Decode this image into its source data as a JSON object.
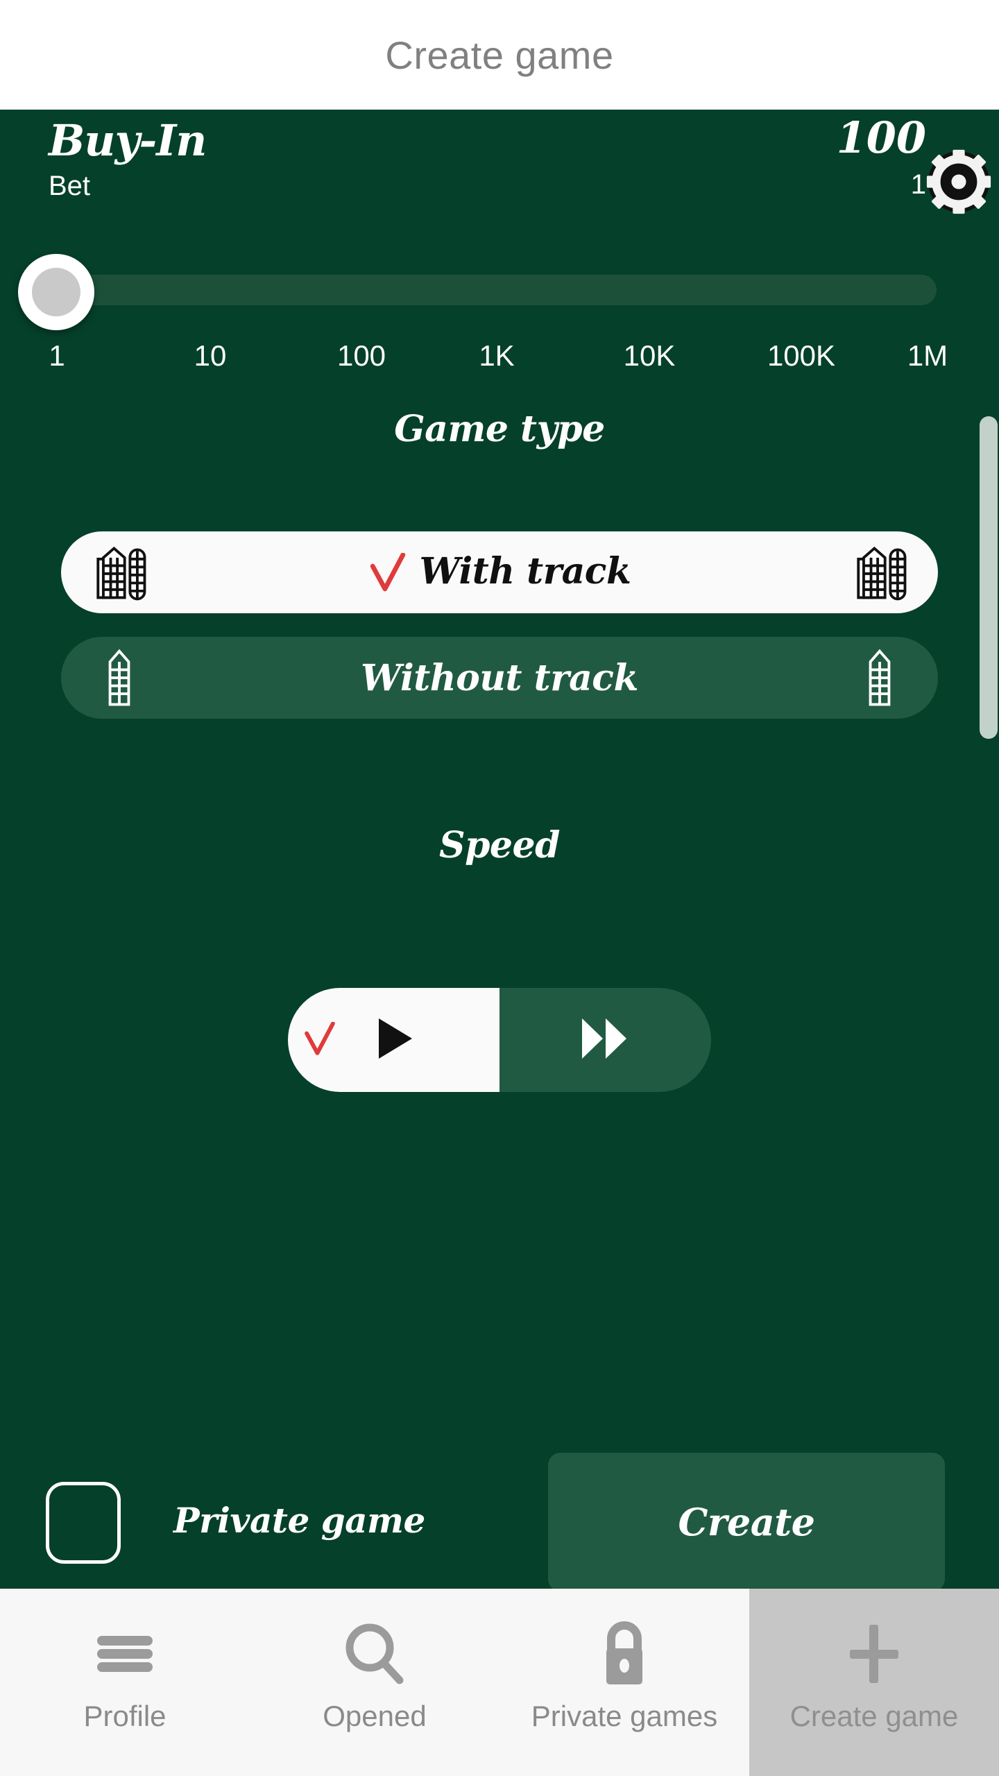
{
  "header": {
    "title": "Create game"
  },
  "buyin": {
    "title": "Buy-In",
    "subtitle": "Bet",
    "amount": "100",
    "count": "1",
    "chip_icon": "poker-chip-icon"
  },
  "slider": {
    "ticks": [
      "1",
      "10",
      "100",
      "1K",
      "10K",
      "100K",
      "1M"
    ],
    "value": "1",
    "thumb_position_percent": 0
  },
  "game_type": {
    "title": "Game type",
    "options": [
      {
        "label": "With track",
        "selected": true,
        "icon": "board-with-track-icon",
        "check": "red-check-icon"
      },
      {
        "label": "Without track",
        "selected": false,
        "icon": "board-without-track-icon"
      }
    ]
  },
  "speed": {
    "title": "Speed",
    "options": [
      {
        "icon": "play-icon",
        "selected": true,
        "check": "red-check-icon"
      },
      {
        "icon": "fast-forward-icon",
        "selected": false
      }
    ]
  },
  "footer": {
    "private_game_label": "Private game",
    "private_game_checked": false,
    "create_label": "Create"
  },
  "bottom_nav": {
    "items": [
      {
        "label": "Profile",
        "icon": "hamburger-menu-icon",
        "active": false
      },
      {
        "label": "Opened",
        "icon": "search-icon",
        "active": false
      },
      {
        "label": "Private games",
        "icon": "lock-icon",
        "active": false
      },
      {
        "label": "Create game",
        "icon": "plus-icon",
        "active": true
      }
    ]
  },
  "colors": {
    "background_green": "#05402a",
    "panel_green": "#215a43",
    "track_green": "#1c5039",
    "selected_white": "#fafafa",
    "accent_red": "#e03b3b",
    "nav_bg": "#f7f7f7",
    "nav_active_bg": "#c6c6c6",
    "nav_icon_gray": "#9b9b9b",
    "title_gray": "#808080",
    "scrollbar": "#c2d2cb"
  }
}
